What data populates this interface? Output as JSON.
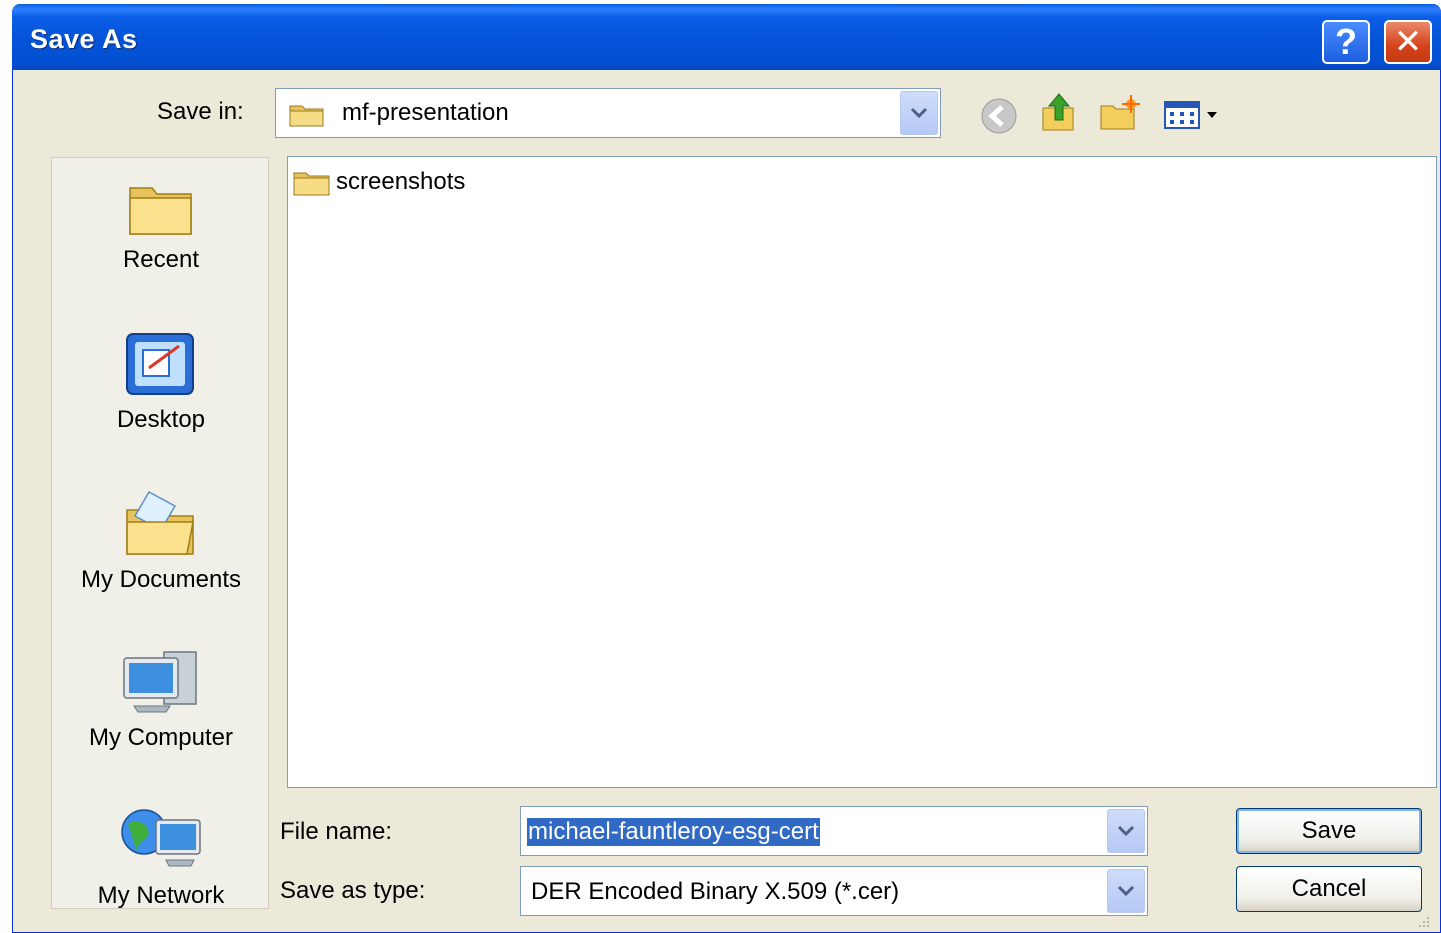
{
  "window": {
    "title": "Save As"
  },
  "toolbar": {
    "save_in_label": "Save in:",
    "save_in_value": "mf-presentation"
  },
  "places": [
    {
      "label": "Recent",
      "icon": "recent-folder-icon"
    },
    {
      "label": "Desktop",
      "icon": "desktop-icon"
    },
    {
      "label": "My Documents",
      "icon": "my-documents-icon"
    },
    {
      "label": "My Computer",
      "icon": "my-computer-icon"
    },
    {
      "label": "My Network",
      "icon": "my-network-icon"
    }
  ],
  "files": [
    {
      "name": "screenshots",
      "type": "folder"
    }
  ],
  "form": {
    "file_name_label": "File name:",
    "file_name_value": "michael-fauntleroy-esg-cert",
    "save_as_type_label": "Save as type:",
    "save_as_type_value": "DER Encoded Binary X.509 (*.cer)"
  },
  "buttons": {
    "save": "Save",
    "cancel": "Cancel"
  },
  "colors": {
    "titlebar": "#0453d6",
    "dialog_bg": "#ece9d8",
    "selection": "#316ac5"
  }
}
